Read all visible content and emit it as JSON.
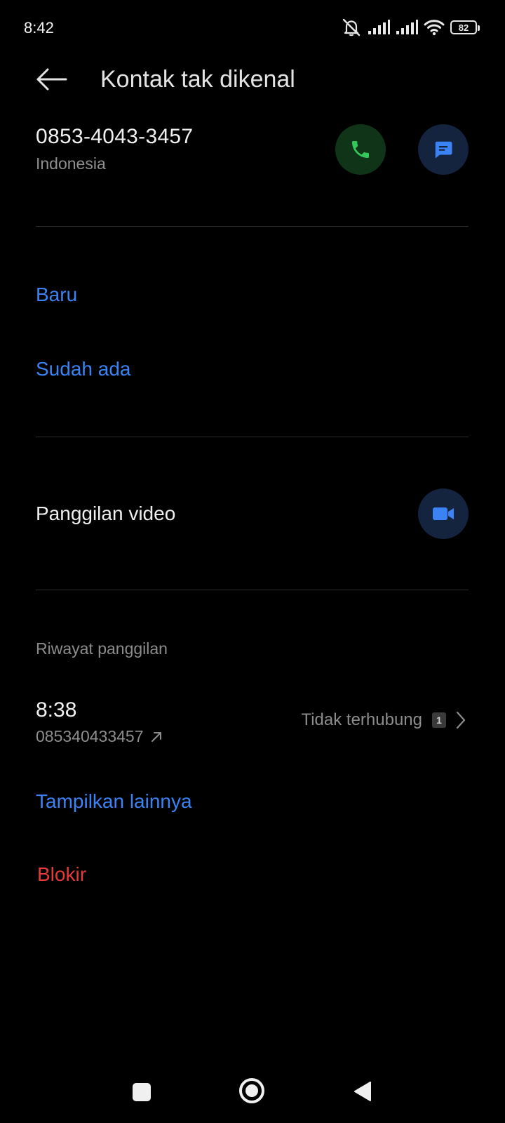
{
  "status_bar": {
    "time": "8:42",
    "battery": "82"
  },
  "header": {
    "title": "Kontak tak dikenal"
  },
  "contact": {
    "number": "0853-4043-3457",
    "region": "Indonesia"
  },
  "add_contact": {
    "new_label": "Baru",
    "existing_label": "Sudah ada"
  },
  "video": {
    "label": "Panggilan video"
  },
  "history": {
    "section_label": "Riwayat panggilan",
    "entries": [
      {
        "time": "8:38",
        "number": "085340433457",
        "status": "Tidak terhubung",
        "sim": "1"
      }
    ]
  },
  "actions": {
    "show_more": "Tampilkan lainnya",
    "block": "Blokir"
  },
  "colors": {
    "accent_blue": "#3b83f4",
    "danger_red": "#e53935",
    "call_green": "#34c759"
  },
  "icons": [
    "mute-icon",
    "signal-icon",
    "wifi-icon",
    "battery-icon",
    "back-arrow-icon",
    "phone-icon",
    "message-icon",
    "video-camera-icon",
    "outgoing-call-icon",
    "sim-card-icon",
    "chevron-right-icon",
    "nav-recents-icon",
    "nav-home-icon",
    "nav-back-icon"
  ]
}
